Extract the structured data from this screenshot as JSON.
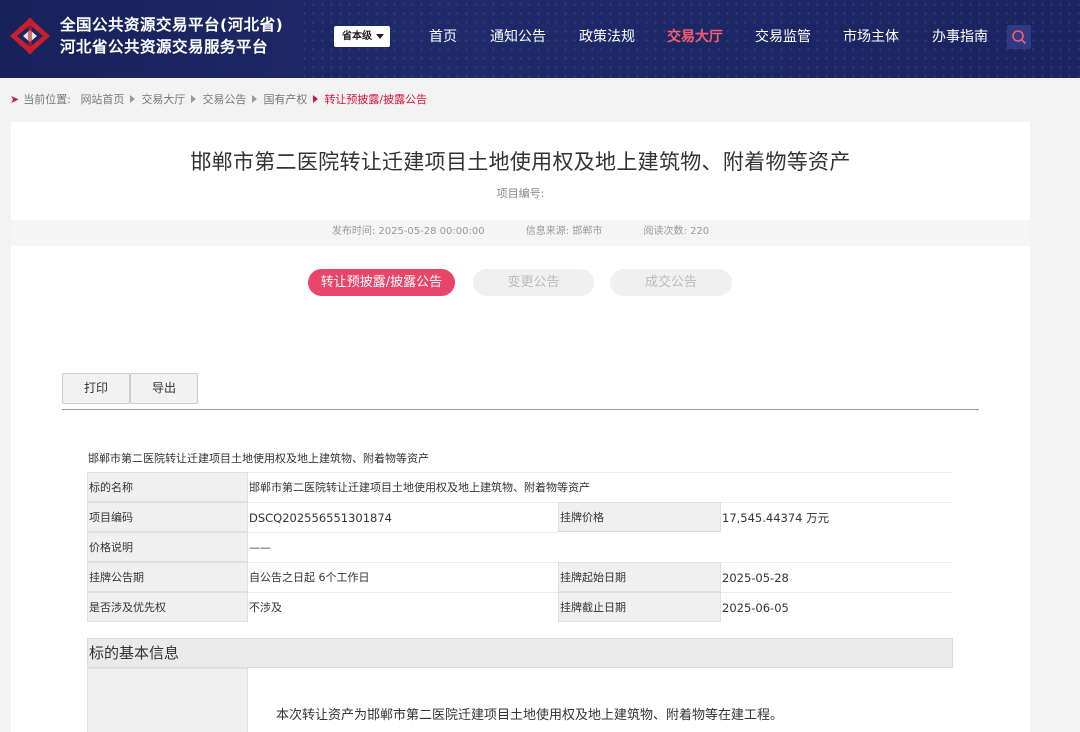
{
  "header": {
    "title_line1": "全国公共资源交易平台(河北省)",
    "title_line2": "河北省公共资源交易服务平台",
    "level_select": "省本级",
    "nav": [
      "首页",
      "通知公告",
      "政策法规",
      "交易大厅",
      "交易监管",
      "市场主体",
      "办事指南"
    ],
    "active_nav": "交易大厅"
  },
  "breadcrumb": {
    "prefix": "当前位置:",
    "items": [
      "网站首页",
      "交易大厅",
      "交易公告",
      "国有产权"
    ],
    "current": "转让预披露/披露公告"
  },
  "page": {
    "title": "邯郸市第二医院转让迁建项目土地使用权及地上建筑物、附着物等资产",
    "project_no_label": "项目编号:",
    "meta": {
      "publish_time": "发布时间: 2025-05-28 00:00:00",
      "source": "信息来源:   邯郸市",
      "views": "阅读次数:   220"
    },
    "tabs": [
      "转让预披露/披露公告",
      "变更公告",
      "成交公告"
    ],
    "tools": {
      "print": "打印",
      "export": "导出"
    }
  },
  "document": {
    "heading": "邯郸市第二医院转让迁建项目土地使用权及地上建筑物、附着物等资产",
    "rows": {
      "subject_name_label": "标的名称",
      "subject_name_value": "邯郸市第二医院转让迁建项目土地使用权及地上建筑物、附着物等资产",
      "project_code_label": "项目编码",
      "project_code_value": "DSCQ202556551301874",
      "listing_price_label": "挂牌价格",
      "listing_price_value": "17,545.44374 万元",
      "price_note_label": "价格说明",
      "price_note_value": "——",
      "listing_period_label": "挂牌公告期",
      "listing_period_value": "自公告之日起 6个工作日",
      "start_date_label": "挂牌起始日期",
      "start_date_value": "2025-05-28",
      "priority_label": "是否涉及优先权",
      "priority_value": "不涉及",
      "end_date_label": "挂牌截止日期",
      "end_date_value": "2025-06-05"
    },
    "section_title": "标的基本信息",
    "section_text": "本次转让资产为邯郸市第二医院迁建项目土地使用权及地上建筑物、附着物等在建工程。"
  },
  "colors": {
    "header_bg": "#1b255f",
    "accent": "#e8456a",
    "breadcrumb_current": "#d8173a"
  }
}
